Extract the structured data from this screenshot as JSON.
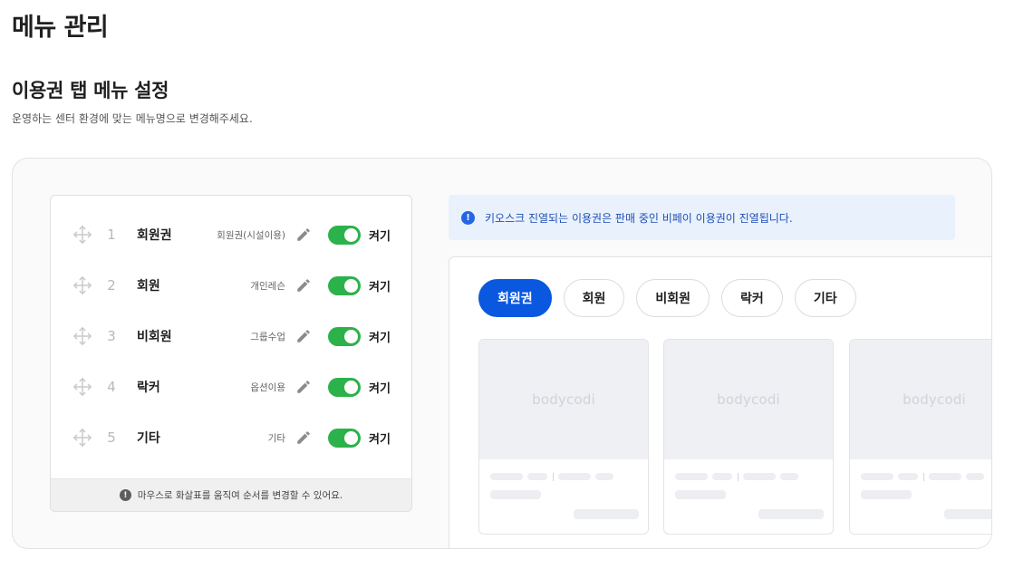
{
  "page": {
    "title": "메뉴 관리",
    "section_title": "이용권 탭 메뉴 설정",
    "section_desc": "운영하는 센터 환경에 맞는 메뉴명으로 변경해주세요."
  },
  "menu_list": {
    "items": [
      {
        "num": "1",
        "name": "회원권",
        "sub": "회원권(시설이용)",
        "toggle_label": "켜기",
        "enabled": true
      },
      {
        "num": "2",
        "name": "회원",
        "sub": "개인레슨",
        "toggle_label": "켜기",
        "enabled": true
      },
      {
        "num": "3",
        "name": "비회원",
        "sub": "그룹수업",
        "toggle_label": "켜기",
        "enabled": true
      },
      {
        "num": "4",
        "name": "락커",
        "sub": "옵션이용",
        "toggle_label": "켜기",
        "enabled": true
      },
      {
        "num": "5",
        "name": "기타",
        "sub": "기타",
        "toggle_label": "켜기",
        "enabled": true
      }
    ],
    "footer_note": "마우스로 화살표를 움직여 순서를 변경할 수 있어요."
  },
  "info_banner": {
    "text": "키오스크 진열되는 이용권은 판매 중인 비페이 이용권이 진열됩니다."
  },
  "preview": {
    "tabs": [
      "회원권",
      "회원",
      "비회원",
      "락커",
      "기타"
    ],
    "active_tab": "회원권",
    "card_logo": "bodycodi"
  },
  "colors": {
    "accent": "#0a58e0",
    "toggle_on": "#2cb24a",
    "info_bg": "#e9f1fd",
    "info_text": "#1f4fb5"
  },
  "icons": {
    "drag": "move-arrows-icon",
    "edit": "pencil-icon",
    "notice": "exclamation-circle-icon",
    "info": "info-circle-icon"
  }
}
